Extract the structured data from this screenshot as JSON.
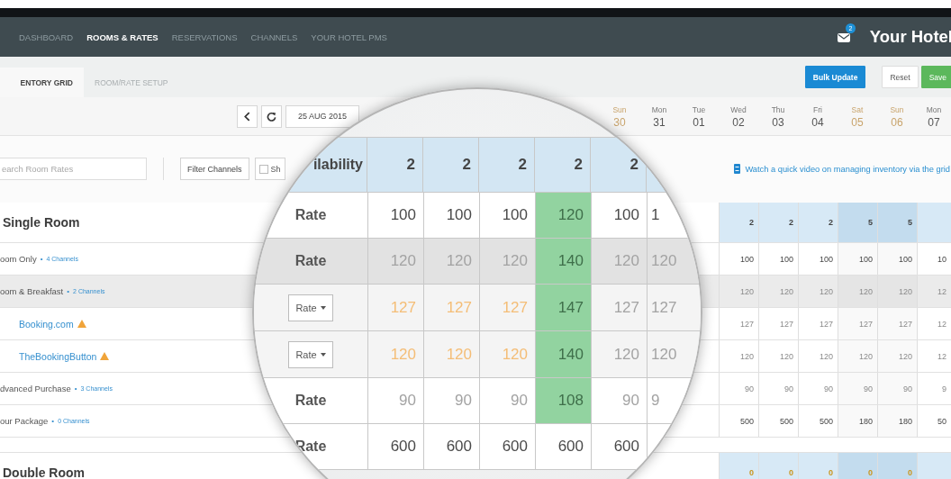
{
  "nav": {
    "items": [
      {
        "label": "DASHBOARD",
        "selected": false
      },
      {
        "label": "ROOMS & RATES",
        "selected": true
      },
      {
        "label": "RESERVATIONS",
        "selected": false
      },
      {
        "label": "CHANNELS",
        "selected": false
      },
      {
        "label": "YOUR HOTEL PMS",
        "selected": false
      }
    ],
    "badge": "2",
    "hotel": "Your Hotel"
  },
  "subnav": {
    "tabs": [
      {
        "label": "ENTORY GRID",
        "selected": true
      },
      {
        "label": "ROOM/RATE SETUP",
        "selected": false
      }
    ],
    "buttons": [
      {
        "label": "Bulk Update",
        "kind": "primary"
      },
      {
        "label": "Reset",
        "kind": "default"
      },
      {
        "label": "Save",
        "kind": "success"
      }
    ]
  },
  "toolbar": {
    "date": "25 AUG 2015"
  },
  "dates": [
    {
      "day": "Sun",
      "date": "30",
      "weekend": true
    },
    {
      "day": "Mon",
      "date": "31",
      "weekend": false
    },
    {
      "day": "Tue",
      "date": "01",
      "weekend": false
    },
    {
      "day": "Wed",
      "date": "02",
      "weekend": false
    },
    {
      "day": "Thu",
      "date": "03",
      "weekend": false
    },
    {
      "day": "Fri",
      "date": "04",
      "weekend": false
    },
    {
      "day": "Sat",
      "date": "05",
      "weekend": true
    },
    {
      "day": "Sun",
      "date": "06",
      "weekend": true
    },
    {
      "day": "Mon",
      "date": "07",
      "weekend": false
    }
  ],
  "filters": {
    "search_placeholder": "earch Room Rates",
    "filter_button": "Filter Channels",
    "checkbox": {
      "label": "Sh",
      "checked": false
    },
    "video_link": "Watch a quick video on managing inventory via the grid"
  },
  "grid": {
    "rows": [
      {
        "kind": "room",
        "label": "Single Room",
        "shaded": false,
        "warning": false,
        "cells": [
          {
            "value": "2",
            "kind": "count"
          },
          {
            "value": "2",
            "kind": "count"
          },
          {
            "value": "2",
            "kind": "count"
          },
          {
            "value": "5",
            "kind": "count"
          },
          {
            "value": "5",
            "kind": "count"
          }
        ]
      },
      {
        "kind": "rate",
        "label": "oom Only",
        "bullet": "•",
        "channels": "4 Channels",
        "shaded": false,
        "warning": false,
        "cells": [
          {
            "value": "100",
            "kind": "strong"
          },
          {
            "value": "100",
            "kind": "strong"
          },
          {
            "value": "100",
            "kind": "strong"
          },
          {
            "value": "100",
            "kind": "strong"
          },
          {
            "value": "100",
            "kind": "strong"
          },
          {
            "value": "10",
            "kind": "strong"
          }
        ]
      },
      {
        "kind": "rate",
        "label": "oom & Breakfast",
        "bullet": "•",
        "channels": "2 Channels",
        "shaded": true,
        "warning": false,
        "cells": [
          {
            "value": "120",
            "kind": "muted"
          },
          {
            "value": "120",
            "kind": "muted"
          },
          {
            "value": "120",
            "kind": "muted"
          },
          {
            "value": "120",
            "kind": "muted"
          },
          {
            "value": "120",
            "kind": "muted"
          },
          {
            "value": "12",
            "kind": "muted"
          }
        ]
      },
      {
        "kind": "channel",
        "label": "Booking.com",
        "shaded": false,
        "warning": true,
        "cells": [
          {
            "value": "127",
            "kind": "muted"
          },
          {
            "value": "127",
            "kind": "muted"
          },
          {
            "value": "127",
            "kind": "muted"
          },
          {
            "value": "127",
            "kind": "muted"
          },
          {
            "value": "127",
            "kind": "muted"
          },
          {
            "value": "12",
            "kind": "muted"
          }
        ]
      },
      {
        "kind": "channel",
        "label": "TheBookingButton",
        "shaded": false,
        "warning": true,
        "cells": [
          {
            "value": "120",
            "kind": "muted"
          },
          {
            "value": "120",
            "kind": "muted"
          },
          {
            "value": "120",
            "kind": "muted"
          },
          {
            "value": "120",
            "kind": "muted"
          },
          {
            "value": "120",
            "kind": "muted"
          },
          {
            "value": "12",
            "kind": "muted"
          }
        ]
      },
      {
        "kind": "rate",
        "label": "dvanced Purchase",
        "bullet": "•",
        "channels": "3 Channels",
        "shaded": false,
        "warning": false,
        "cells": [
          {
            "value": "90",
            "kind": "muted"
          },
          {
            "value": "90",
            "kind": "muted"
          },
          {
            "value": "90",
            "kind": "muted"
          },
          {
            "value": "90",
            "kind": "muted"
          },
          {
            "value": "90",
            "kind": "muted"
          },
          {
            "value": "9",
            "kind": "muted"
          }
        ]
      },
      {
        "kind": "rate",
        "label": "our Package",
        "bullet": "•",
        "channels": "0 Channels",
        "shaded": false,
        "warning": false,
        "cells": [
          {
            "value": "500",
            "kind": "strong"
          },
          {
            "value": "500",
            "kind": "strong"
          },
          {
            "value": "500",
            "kind": "strong"
          },
          {
            "value": "180",
            "kind": "strong"
          },
          {
            "value": "180",
            "kind": "strong"
          },
          {
            "value": "50",
            "kind": "strong"
          }
        ]
      },
      {
        "kind": "spacer"
      },
      {
        "kind": "room",
        "label": "Double Room",
        "shaded": false,
        "warning": false,
        "cells": [
          {
            "value": "0",
            "kind": "zero"
          },
          {
            "value": "0",
            "kind": "zero"
          },
          {
            "value": "0",
            "kind": "zero"
          },
          {
            "value": "0",
            "kind": "zero"
          },
          {
            "value": "0",
            "kind": "zero"
          }
        ]
      }
    ]
  },
  "magnifier": {
    "rows": [
      {
        "kind": "availability",
        "label": "ilability",
        "shaded": false,
        "cells": [
          {
            "value": "2",
            "kind": "count"
          },
          {
            "value": "2",
            "kind": "count"
          },
          {
            "value": "2",
            "kind": "count"
          },
          {
            "value": "2",
            "kind": "count"
          },
          {
            "value": "2",
            "kind": "count"
          }
        ]
      },
      {
        "kind": "rate",
        "label": "Rate",
        "shaded": false,
        "cells": [
          {
            "value": "100",
            "kind": "strong"
          },
          {
            "value": "100",
            "kind": "strong"
          },
          {
            "value": "100",
            "kind": "strong"
          },
          {
            "value": "120",
            "kind": "green"
          },
          {
            "value": "100",
            "kind": "strong"
          },
          {
            "value": "1",
            "kind": "strong"
          }
        ]
      },
      {
        "kind": "rate",
        "label": "Rate",
        "shaded": true,
        "cells": [
          {
            "value": "120",
            "kind": "muted"
          },
          {
            "value": "120",
            "kind": "muted"
          },
          {
            "value": "120",
            "kind": "muted"
          },
          {
            "value": "140",
            "kind": "green"
          },
          {
            "value": "120",
            "kind": "muted"
          },
          {
            "value": "120",
            "kind": "muted"
          }
        ]
      },
      {
        "kind": "dropdown",
        "label": "Rate",
        "shaded": false,
        "cells": [
          {
            "value": "127",
            "kind": "warn"
          },
          {
            "value": "127",
            "kind": "warn"
          },
          {
            "value": "127",
            "kind": "warn"
          },
          {
            "value": "147",
            "kind": "green"
          },
          {
            "value": "127",
            "kind": "muted"
          },
          {
            "value": "127",
            "kind": "muted"
          }
        ]
      },
      {
        "kind": "dropdown",
        "label": "Rate",
        "shaded": false,
        "cells": [
          {
            "value": "120",
            "kind": "warn"
          },
          {
            "value": "120",
            "kind": "warn"
          },
          {
            "value": "120",
            "kind": "warn"
          },
          {
            "value": "140",
            "kind": "green"
          },
          {
            "value": "120",
            "kind": "muted"
          },
          {
            "value": "120",
            "kind": "muted"
          }
        ]
      },
      {
        "kind": "rate",
        "label": "Rate",
        "shaded": false,
        "cells": [
          {
            "value": "90",
            "kind": "muted"
          },
          {
            "value": "90",
            "kind": "muted"
          },
          {
            "value": "90",
            "kind": "muted"
          },
          {
            "value": "108",
            "kind": "green"
          },
          {
            "value": "90",
            "kind": "muted"
          },
          {
            "value": "9",
            "kind": "muted"
          }
        ]
      },
      {
        "kind": "rate",
        "label": "Rate",
        "shaded": false,
        "cells": [
          {
            "value": "600",
            "kind": "strong"
          },
          {
            "value": "600",
            "kind": "strong"
          },
          {
            "value": "600",
            "kind": "strong"
          },
          {
            "value": "600",
            "kind": "strong"
          },
          {
            "value": "600",
            "kind": "strong"
          }
        ]
      }
    ]
  }
}
